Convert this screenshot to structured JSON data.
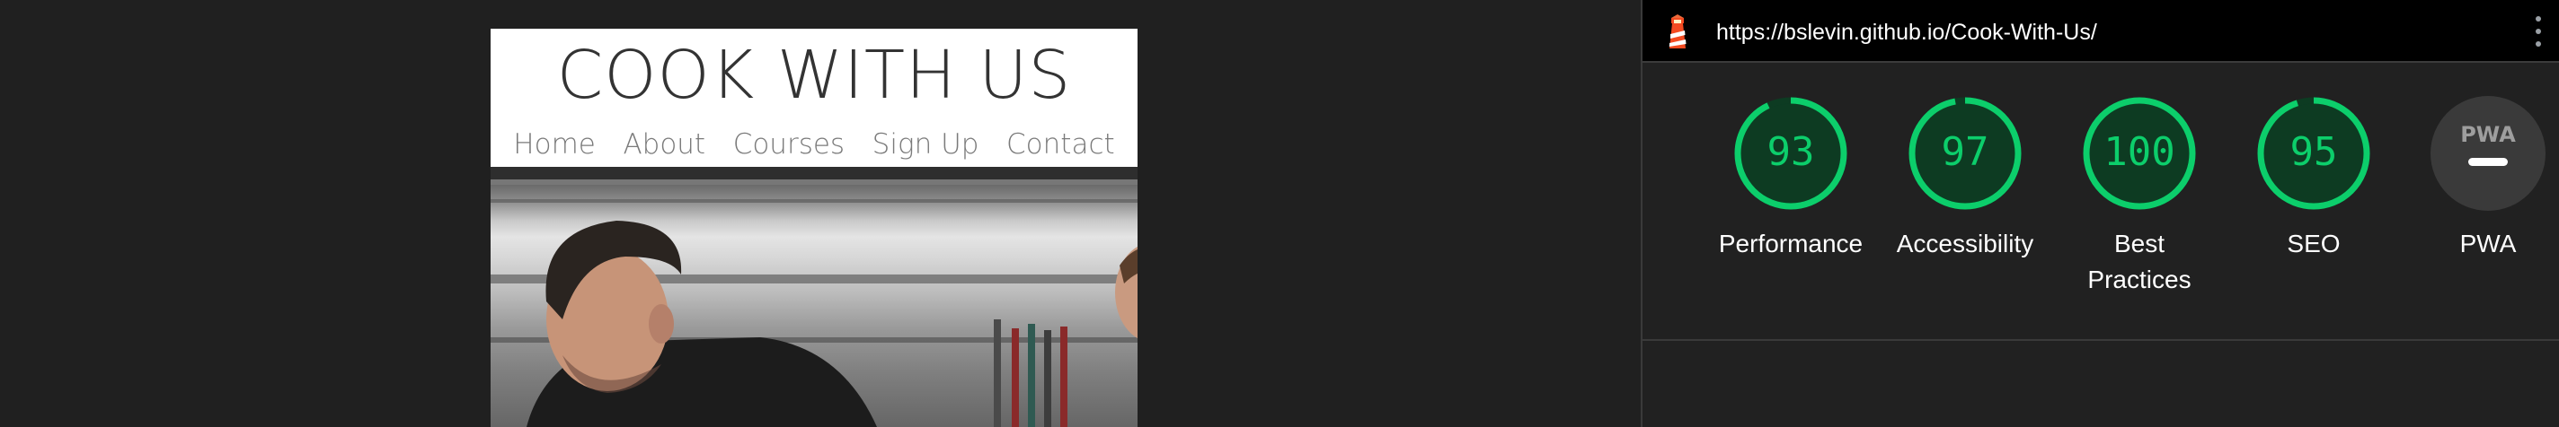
{
  "site": {
    "title": "COOK WITH US",
    "nav": [
      {
        "label": "Home"
      },
      {
        "label": "About"
      },
      {
        "label": "Courses"
      },
      {
        "label": "Sign Up"
      },
      {
        "label": "Contact"
      }
    ]
  },
  "lighthouse": {
    "url": "https://bslevin.github.io/Cook-With-Us/",
    "logo_icon": "lighthouse-icon",
    "menu_icon": "kebab-menu-icon",
    "colors": {
      "pass": "#0cce6b",
      "pass_fill": "#0d3b22",
      "pwa_bg": "#3a3a3a",
      "pwa_text": "#9e9e9e"
    },
    "categories": [
      {
        "score": "93",
        "label": "Performance"
      },
      {
        "score": "97",
        "label": "Accessibility"
      },
      {
        "score": "100",
        "label_line1": "Best",
        "label_line2": "Practices"
      },
      {
        "score": "95",
        "label": "SEO"
      },
      {
        "badge": "PWA",
        "label": "PWA"
      }
    ]
  }
}
